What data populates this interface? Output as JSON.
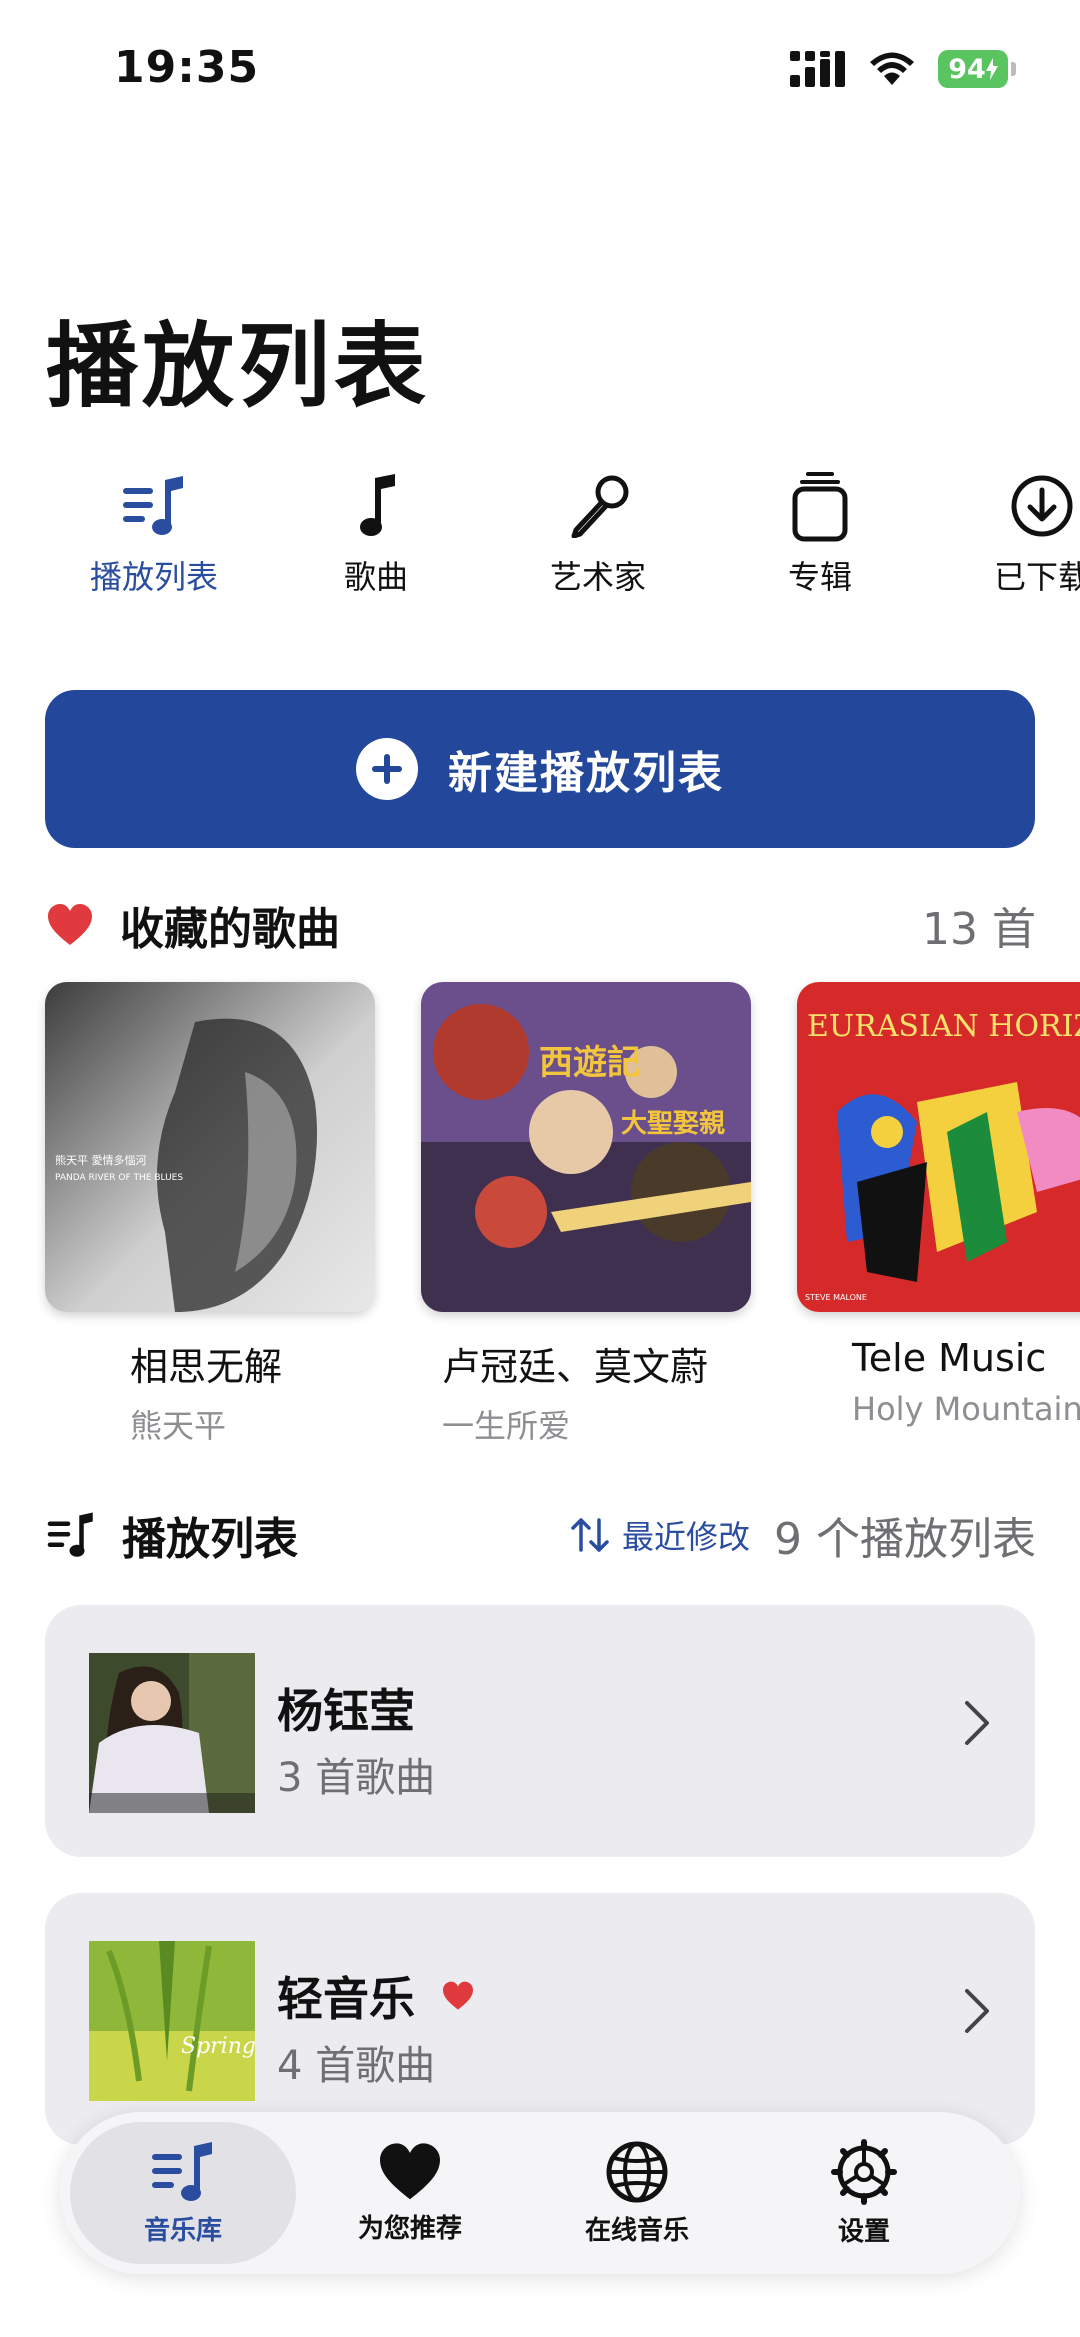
{
  "status_bar": {
    "time": "19:35",
    "battery": "94"
  },
  "page_title": "播放列表",
  "categories": [
    {
      "label": "播放列表",
      "icon": "playlist-icon",
      "active": true
    },
    {
      "label": "歌曲",
      "icon": "music-note-icon",
      "active": false
    },
    {
      "label": "艺术家",
      "icon": "microphone-icon",
      "active": false
    },
    {
      "label": "专辑",
      "icon": "album-stack-icon",
      "active": false
    },
    {
      "label": "已下载",
      "icon": "download-icon",
      "active": false
    }
  ],
  "new_playlist_button": {
    "label": "新建播放列表"
  },
  "favorites": {
    "title": "收藏的歌曲",
    "count": "13 首",
    "albums": [
      {
        "title": "相思无解",
        "subtitle": "熊天平",
        "cover_text": [
          "熊天平  愛情多惱河",
          "PANDA RIVER OF THE BLUES"
        ]
      },
      {
        "title": "卢冠廷、莫文蔚",
        "subtitle": "一生所爱",
        "cover_text": [
          "西遊記",
          "大聖娶親"
        ]
      },
      {
        "title": "Tele Music",
        "subtitle": "Holy Mountain",
        "cover_text": [
          "EURASIAN HORIZO",
          "STEVE MALONE"
        ]
      }
    ]
  },
  "playlists": {
    "title": "播放列表",
    "sort_label": "最近修改",
    "count": "9 个播放列表",
    "items": [
      {
        "name": "杨钰莹",
        "subtitle": "3 首歌曲",
        "favorite": false
      },
      {
        "name": "轻音乐",
        "subtitle": "4 首歌曲",
        "favorite": true,
        "cover_text": "Spring"
      }
    ]
  },
  "tab_bar": [
    {
      "label": "音乐库",
      "icon": "library-icon",
      "active": true
    },
    {
      "label": "为您推荐",
      "icon": "heart-icon",
      "active": false
    },
    {
      "label": "在线音乐",
      "icon": "globe-icon",
      "active": false
    },
    {
      "label": "设置",
      "icon": "settings-icon",
      "active": false
    }
  ],
  "colors": {
    "accent": "#23479a",
    "accent_text": "#2a4da0",
    "heart": "#e03a3e",
    "card_bg": "#ececf0",
    "battery": "#5ac460"
  }
}
